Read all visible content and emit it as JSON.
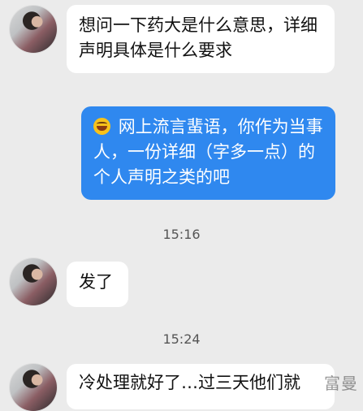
{
  "messages": [
    {
      "text": "想问一下药大是什么意思，详细声明具体是什么要求"
    },
    {
      "text": "网上流言蜚语，你作为当事人，一份详细（字多一点）的个人声明之类的吧"
    },
    {
      "text": "15:16"
    },
    {
      "text": "发了"
    },
    {
      "text": "15:24"
    },
    {
      "text": "冷处理就好了…过三天他们就"
    }
  ],
  "watermark": "富曼",
  "icons": {
    "laugh": "laughing-emoji-icon"
  }
}
